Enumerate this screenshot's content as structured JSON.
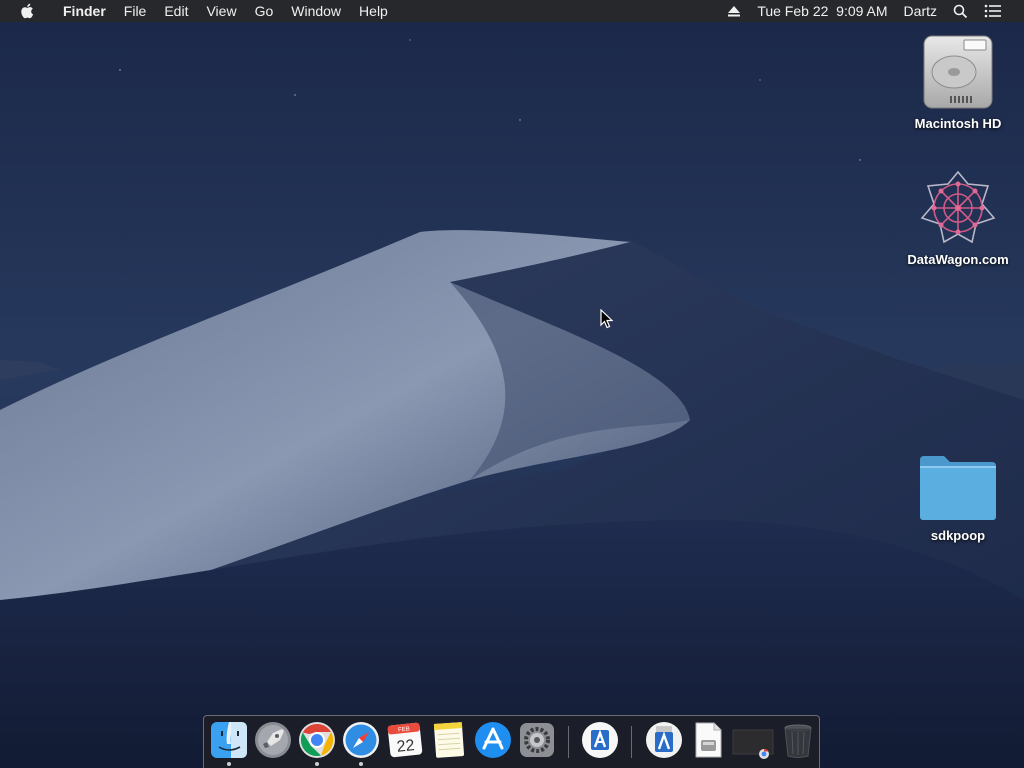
{
  "menubar": {
    "apple_icon": "apple-logo-icon",
    "app_name": "Finder",
    "menus": [
      "File",
      "Edit",
      "View",
      "Go",
      "Window",
      "Help"
    ],
    "eject_icon": "eject-icon",
    "clock": "Tue Feb 22  9:09 AM",
    "user": "Dartz",
    "search_icon": "spotlight-search-icon",
    "notification_icon": "notification-center-icon"
  },
  "desktop": {
    "icons": [
      {
        "label": "Macintosh HD",
        "icon": "hard-drive-icon"
      },
      {
        "label": "DataWagon.com",
        "icon": "datawagon-logo-icon"
      },
      {
        "label": "sdkpoop",
        "icon": "folder-icon"
      }
    ]
  },
  "dock": {
    "calendar_month": "FEB",
    "calendar_day": "22",
    "items": [
      "finder",
      "launchpad",
      "chrome",
      "safari",
      "calendar",
      "notes",
      "app-store",
      "system-preferences",
      "xcode-instruments",
      "xcode-installer",
      "disk-image",
      "chrome-window",
      "trash"
    ],
    "running": [
      "finder",
      "chrome",
      "safari"
    ]
  },
  "colors": {
    "menubar_bg": "#28282a",
    "folder_blue": "#5aaee0",
    "wallpaper_sky": "#1d2b4e"
  }
}
